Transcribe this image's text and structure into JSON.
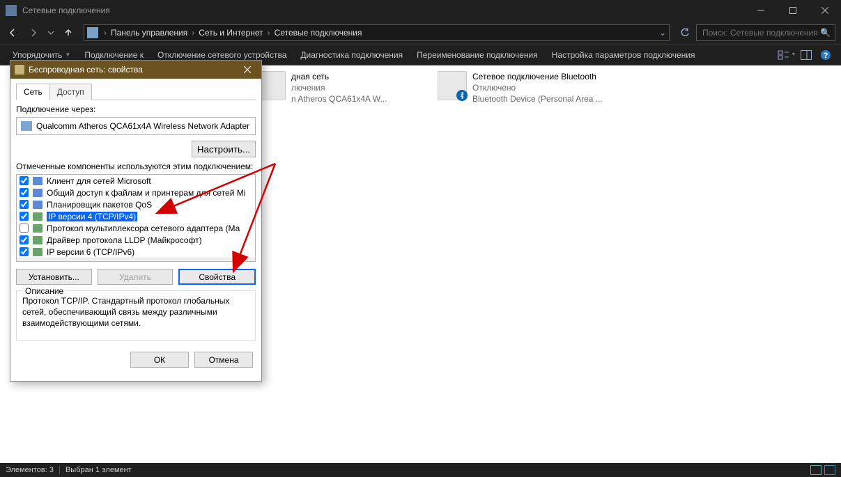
{
  "window": {
    "title": "Сетевые подключения",
    "search_placeholder": "Поиск: Сетевые подключения"
  },
  "breadcrumb": {
    "items": [
      "Панель управления",
      "Сеть и Интернет",
      "Сетевые подключения"
    ]
  },
  "toolbar": {
    "items": [
      "Упорядочить",
      "Подключение к",
      "Отключение сетевого устройства",
      "Диагностика подключения",
      "Переименование подключения",
      "Настройка параметров подключения"
    ]
  },
  "connections": [
    {
      "line1": "дная сеть",
      "line2": "лючения",
      "line3": "n Atheros QCA61x4A W..."
    },
    {
      "line1": "Сетевое подключение Bluetooth",
      "line2": "Отключено",
      "line3": "Bluetooth Device (Personal Area ...",
      "bt": true
    }
  ],
  "statusbar": {
    "count": "Элементов: 3",
    "selected": "Выбран 1 элемент"
  },
  "dialog": {
    "title": "Беспроводная сеть: свойства",
    "tabs": {
      "network": "Сеть",
      "access": "Доступ"
    },
    "connect_via_label": "Подключение через:",
    "adapter": "Qualcomm Atheros QCA61x4A Wireless Network Adapter",
    "configure_btn": "Настроить...",
    "components_label": "Отмеченные компоненты используются этим подключением:",
    "components": [
      {
        "checked": true,
        "label": "Клиент для сетей Microsoft",
        "blue": true
      },
      {
        "checked": true,
        "label": "Общий доступ к файлам и принтерам для сетей Mi",
        "blue": true
      },
      {
        "checked": true,
        "label": "Планировщик пакетов QoS",
        "blue": true
      },
      {
        "checked": true,
        "label": "IP версии 4 (TCP/IPv4)",
        "selected": true
      },
      {
        "checked": false,
        "label": "Протокол мультиплексора сетевого адаптера (Ма"
      },
      {
        "checked": true,
        "label": "Драйвер протокола LLDP (Майкрософт)"
      },
      {
        "checked": true,
        "label": "IP версии 6 (TCP/IPv6)"
      }
    ],
    "install_btn": "Установить...",
    "remove_btn": "Удалить",
    "properties_btn": "Свойства",
    "description_label": "Описание",
    "description_text": "Протокол TCP/IP. Стандартный протокол глобальных сетей, обеспечивающий связь между различными взаимодействующими сетями.",
    "ok_btn": "ОК",
    "cancel_btn": "Отмена"
  }
}
